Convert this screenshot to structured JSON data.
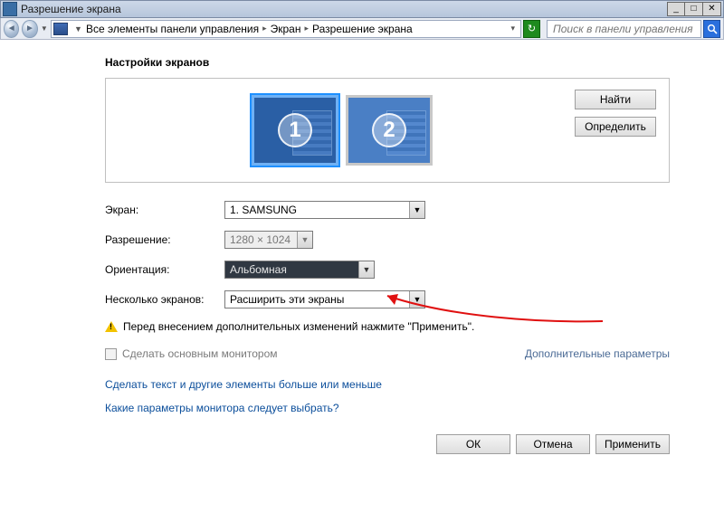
{
  "window": {
    "title": "Разрешение экрана"
  },
  "breadcrumb": {
    "root": "Все элементы панели управления",
    "mid": "Экран",
    "leaf": "Разрешение экрана"
  },
  "search": {
    "placeholder": "Поиск в панели управления"
  },
  "page": {
    "heading": "Настройки экранов",
    "findBtn": "Найти",
    "identifyBtn": "Определить",
    "monitors": [
      "1",
      "2"
    ]
  },
  "form": {
    "screen": {
      "label": "Экран:",
      "value": "1. SAMSUNG"
    },
    "resolution": {
      "label": "Разрешение:",
      "value": "1280 × 1024"
    },
    "orientation": {
      "label": "Ориентация:",
      "value": "Альбомная"
    },
    "multiple": {
      "label": "Несколько экранов:",
      "value": "Расширить эти экраны"
    },
    "warning": "Перед внесением дополнительных изменений нажмите \"Применить\".",
    "makePrimary": "Сделать основным монитором",
    "advanced": "Дополнительные параметры",
    "link1": "Сделать текст и другие элементы больше или меньше",
    "link2": "Какие параметры монитора следует выбрать?"
  },
  "buttons": {
    "ok": "ОК",
    "cancel": "Отмена",
    "apply": "Применить"
  }
}
